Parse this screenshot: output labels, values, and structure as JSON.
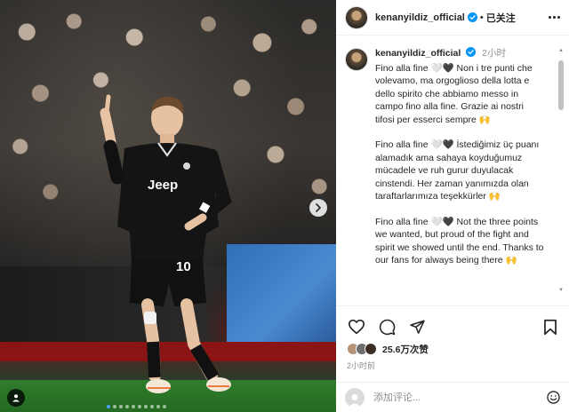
{
  "header": {
    "username": "kenanyildiz_official",
    "separator": "•",
    "follow_state": "已关注",
    "more_label": "more-options"
  },
  "caption": {
    "username": "kenanyildiz_official",
    "time": "2小时",
    "paragraphs": [
      "Fino alla fine 🤍🖤 Non i tre punti che volevamo, ma orgoglioso della lotta e dello spirito che abbiamo messo in campo fino alla fine. Grazie ai nostri tifosi per esserci sempre 🙌",
      "Fino alla fine 🤍🖤 İstediğimiz üç puanı alamadık ama sahaya koyduğumuz mücadele ve ruh gurur duyulacak cinstendi. Her zaman yanımızda olan taraftarlarımıza teşekkürler 🙌",
      "Fino alla fine 🤍🖤 Not the three points we wanted, but proud of the fight and spirit we showed until the end. Thanks to our fans for always being there 🙌"
    ]
  },
  "photo": {
    "jersey_sponsor": "Jeep",
    "jersey_number": "10"
  },
  "actions": {
    "likes": "25.6万次赞",
    "time": "2小时前"
  },
  "comment": {
    "placeholder": "添加评论..."
  },
  "colors": {
    "verified": "#0095f6",
    "text": "#262626",
    "muted": "#8e8e8e",
    "carousel_active": "#4a9ff5"
  },
  "icons": {
    "verified": "verified-badge-icon",
    "like": "heart-icon",
    "comment": "comment-bubble-icon",
    "share": "paper-plane-icon",
    "save": "bookmark-icon",
    "emoji": "smiley-icon",
    "carousel_next": "chevron-right-icon",
    "tag": "user-tag-icon"
  }
}
